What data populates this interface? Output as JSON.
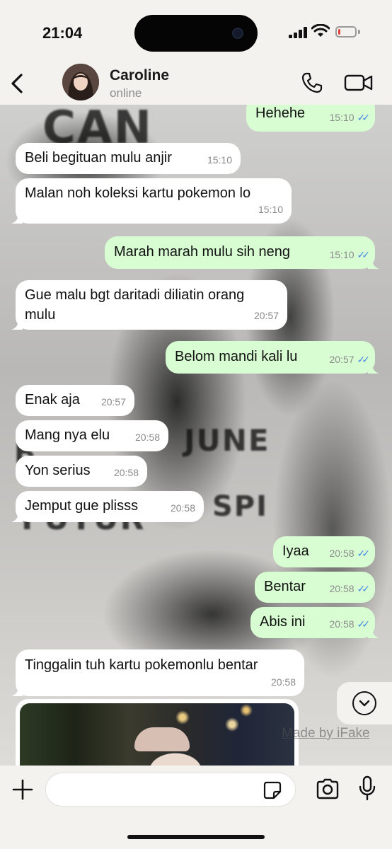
{
  "status_bar": {
    "time": "21:04",
    "battery_level": 0.15,
    "battery_color": "#e0463e"
  },
  "header": {
    "contact_name": "Caroline",
    "contact_status": "online"
  },
  "messages": [
    {
      "dir": "out",
      "text": "Hehehe",
      "time": "15:10",
      "read": true
    },
    {
      "dir": "in",
      "text": "Beli begituan mulu anjir",
      "time": "15:10"
    },
    {
      "dir": "in",
      "text": "Malan noh koleksi kartu pokemon lo",
      "time": "15:10"
    },
    {
      "dir": "out",
      "text": "Marah marah mulu sih neng",
      "time": "15:10",
      "read": true
    },
    {
      "dir": "in",
      "text_line1": "Gue malu bgt daritadi diliatin orang",
      "text_line2": "mulu",
      "time": "20:57"
    },
    {
      "dir": "out",
      "text": "Belom mandi kali lu",
      "time": "20:57",
      "read": true
    },
    {
      "dir": "in",
      "text": "Enak aja",
      "time": "20:57"
    },
    {
      "dir": "in",
      "text": "Mang nya elu",
      "time": "20:58"
    },
    {
      "dir": "in",
      "text": "Yon serius",
      "time": "20:58"
    },
    {
      "dir": "in",
      "text": "Jemput gue plisss",
      "time": "20:58"
    },
    {
      "dir": "out",
      "text": "Iyaa",
      "time": "20:58",
      "read": true
    },
    {
      "dir": "out",
      "text": "Bentar",
      "time": "20:58",
      "read": true
    },
    {
      "dir": "out",
      "text": "Abis ini",
      "time": "20:58",
      "read": true
    },
    {
      "dir": "in",
      "text": "Tinggalin tuh kartu pokemonlu bentar",
      "time": "20:58"
    }
  ],
  "watermark": "Made by iFake",
  "input": {
    "placeholder": "",
    "value": ""
  },
  "icons": {
    "back": "chevron-left-icon",
    "call": "phone-icon",
    "video": "video-camera-icon",
    "scroll": "chevron-down-icon",
    "plus": "plus-icon",
    "sticker": "sticker-icon",
    "camera": "camera-icon",
    "mic": "microphone-icon",
    "read_receipt": "double-check-icon"
  },
  "colors": {
    "outgoing_bubble": "#d9fdd3",
    "incoming_bubble": "#ffffff",
    "read_tick": "#4a8fe0"
  }
}
